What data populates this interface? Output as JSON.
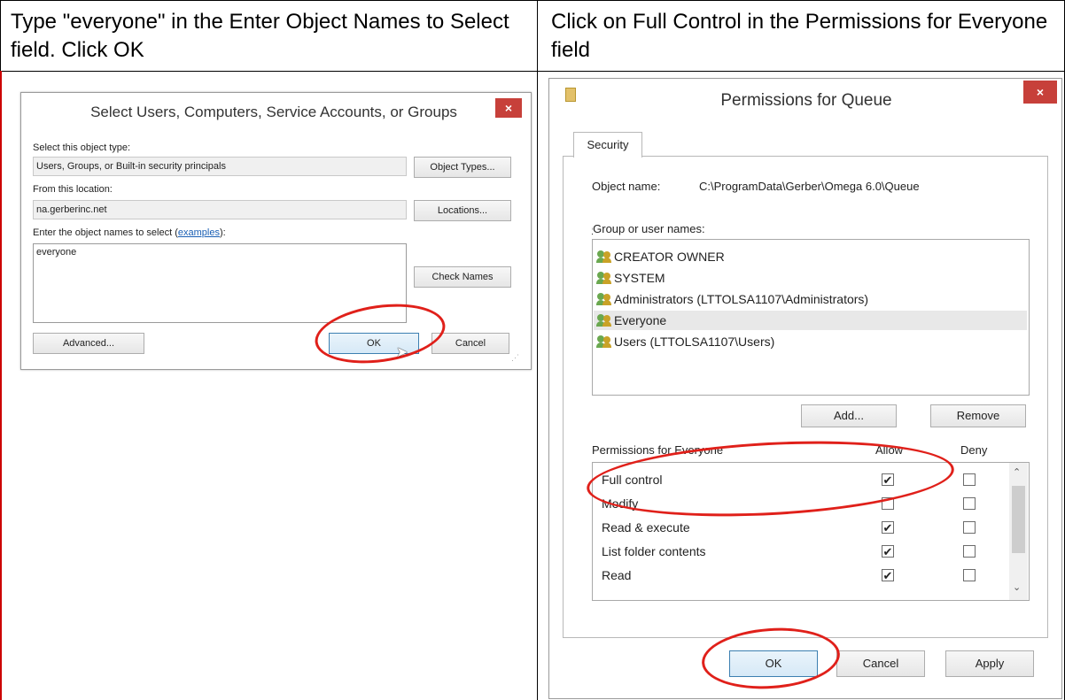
{
  "header": {
    "left": "Type \"everyone\" in the Enter Object Names to Select field. Click OK",
    "right": "Click on Full Control in the Permissions for Everyone field"
  },
  "select_dialog": {
    "title": "Select Users, Computers, Service Accounts, or Groups",
    "close_glyph": "×",
    "object_type_label": "Select this object type:",
    "object_type_value": "Users, Groups, or Built-in security principals",
    "object_types_button": "Object Types...",
    "location_label": "From this location:",
    "location_value": "na.gerberinc.net",
    "locations_button": "Locations...",
    "enter_names_label": "Enter the object names to select (",
    "examples_link": "examples",
    "enter_names_label_end": "):",
    "names_value": "everyone",
    "check_names_button": "Check Names",
    "advanced_button": "Advanced...",
    "ok_button": "OK",
    "cancel_button": "Cancel"
  },
  "perm_dialog": {
    "title": "Permissions for Queue",
    "close_glyph": "×",
    "tab": "Security",
    "object_name_label": "Object name:",
    "object_name_value": "C:\\ProgramData\\Gerber\\Omega 6.0\\Queue",
    "group_label": "Group or user names:",
    "users": [
      {
        "name": "CREATOR OWNER",
        "selected": false
      },
      {
        "name": "SYSTEM",
        "selected": false
      },
      {
        "name": "Administrators (LTTOLSA1107\\Administrators)",
        "selected": false
      },
      {
        "name": "Everyone",
        "selected": true
      },
      {
        "name": "Users (LTTOLSA1107\\Users)",
        "selected": false
      }
    ],
    "add_button": "Add...",
    "remove_button": "Remove",
    "permissions_label": "Permissions for Everyone",
    "allow_header": "Allow",
    "deny_header": "Deny",
    "permissions": [
      {
        "name": "Full control",
        "allow": true,
        "deny": false
      },
      {
        "name": "Modify",
        "allow": false,
        "deny": false
      },
      {
        "name": "Read & execute",
        "allow": true,
        "deny": false
      },
      {
        "name": "List folder contents",
        "allow": true,
        "deny": false
      },
      {
        "name": "Read",
        "allow": true,
        "deny": false
      }
    ],
    "ok_button": "OK",
    "cancel_button": "Cancel",
    "apply_button": "Apply"
  },
  "colors": {
    "annotation_red": "#e0201a",
    "close_red": "#c7403a",
    "link_blue": "#1a5fb4"
  }
}
